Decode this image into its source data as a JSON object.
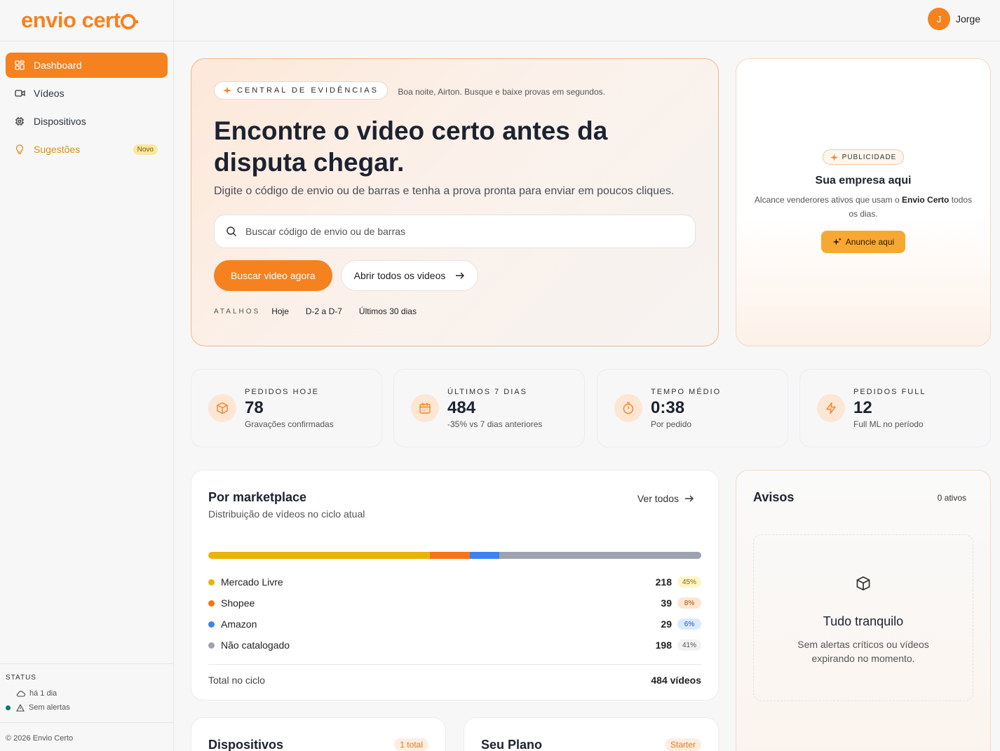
{
  "brand": {
    "name": "envio cert"
  },
  "sidebar": {
    "items": [
      {
        "label": "Dashboard",
        "icon": "dashboard-icon"
      },
      {
        "label": "Vídeos",
        "icon": "video-icon"
      },
      {
        "label": "Dispositivos",
        "icon": "chip-icon"
      },
      {
        "label": "Sugestões",
        "icon": "lightbulb-icon",
        "badge": "Novo"
      }
    ],
    "status": {
      "title": "STATUS",
      "sync": "há 1 dia",
      "alerts": "Sem alertas"
    },
    "copyright": "© 2026 Envio Certo"
  },
  "topbar": {
    "avatar_initial": "J",
    "user_name": "Jorge"
  },
  "hero": {
    "chip": "CENTRAL DE EVIDÊNCIAS",
    "greeting": "Boa noite, Airton. Busque e baixe provas em segundos.",
    "title": "Encontre o video certo antes da disputa chegar.",
    "subtitle": "Digite o código de envio ou de barras e tenha a prova pronta para enviar em poucos cliques.",
    "search_placeholder": "Buscar código de envio ou de barras",
    "primary_button": "Buscar video agora",
    "secondary_button": "Abrir todos os videos",
    "shortcuts_label": "ATALHOS",
    "shortcuts": [
      "Hoje",
      "D-2 a D-7",
      "Últimos 30 dias"
    ]
  },
  "ad": {
    "chip": "PUBLICIDADE",
    "title": "Sua empresa aqui",
    "text_before": "Alcance venderores ativos que usam o ",
    "text_bold": "Envio Certo",
    "text_after": " todos os dias.",
    "button": "Anuncie aqui"
  },
  "kpis": [
    {
      "label": "PEDIDOS HOJE",
      "value": "78",
      "sub": "Gravações confirmadas",
      "icon": "box-icon"
    },
    {
      "label": "ÚLTIMOS 7 DIAS",
      "value": "484",
      "sub": "-35% vs 7 dias anteriores",
      "icon": "calendar-icon"
    },
    {
      "label": "TEMPO MÉDIO",
      "value": "0:38",
      "sub": "Por pedido",
      "icon": "timer-icon"
    },
    {
      "label": "PEDIDOS FULL",
      "value": "12",
      "sub": "Full ML no período",
      "icon": "bolt-icon"
    }
  ],
  "marketplace": {
    "title": "Por marketplace",
    "description": "Distribuição de vídeos no ciclo atual",
    "see_all": "Ver todos",
    "rows": [
      {
        "name": "Mercado Livre",
        "value": "218",
        "pct": "45%",
        "share": 45,
        "color": "#eab308",
        "pct_bg": "#fdf6c8",
        "pct_fg": "#8a6a00"
      },
      {
        "name": "Shopee",
        "value": "39",
        "pct": "8%",
        "share": 8,
        "color": "#f97316",
        "pct_bg": "#fde6d3",
        "pct_fg": "#b04a00"
      },
      {
        "name": "Amazon",
        "value": "29",
        "pct": "6%",
        "share": 6,
        "color": "#3b82f6",
        "pct_bg": "#dbeafe",
        "pct_fg": "#1d4ed8"
      },
      {
        "name": "Não catalogado",
        "value": "198",
        "pct": "41%",
        "share": 41,
        "color": "#9ca3af",
        "pct_bg": "#f1f1f3",
        "pct_fg": "#555555"
      }
    ],
    "total_label": "Total no ciclo",
    "total_value": "484 vídeos"
  },
  "avisos": {
    "title": "Avisos",
    "count": "0 ativos",
    "empty_title": "Tudo tranquilo",
    "empty_text": "Sem alertas críticos ou vídeos expirando no momento."
  },
  "bottom": {
    "devices_title": "Dispositivos",
    "devices_pill": "1 total",
    "plan_title": "Seu Plano",
    "plan_pill": "Starter"
  }
}
